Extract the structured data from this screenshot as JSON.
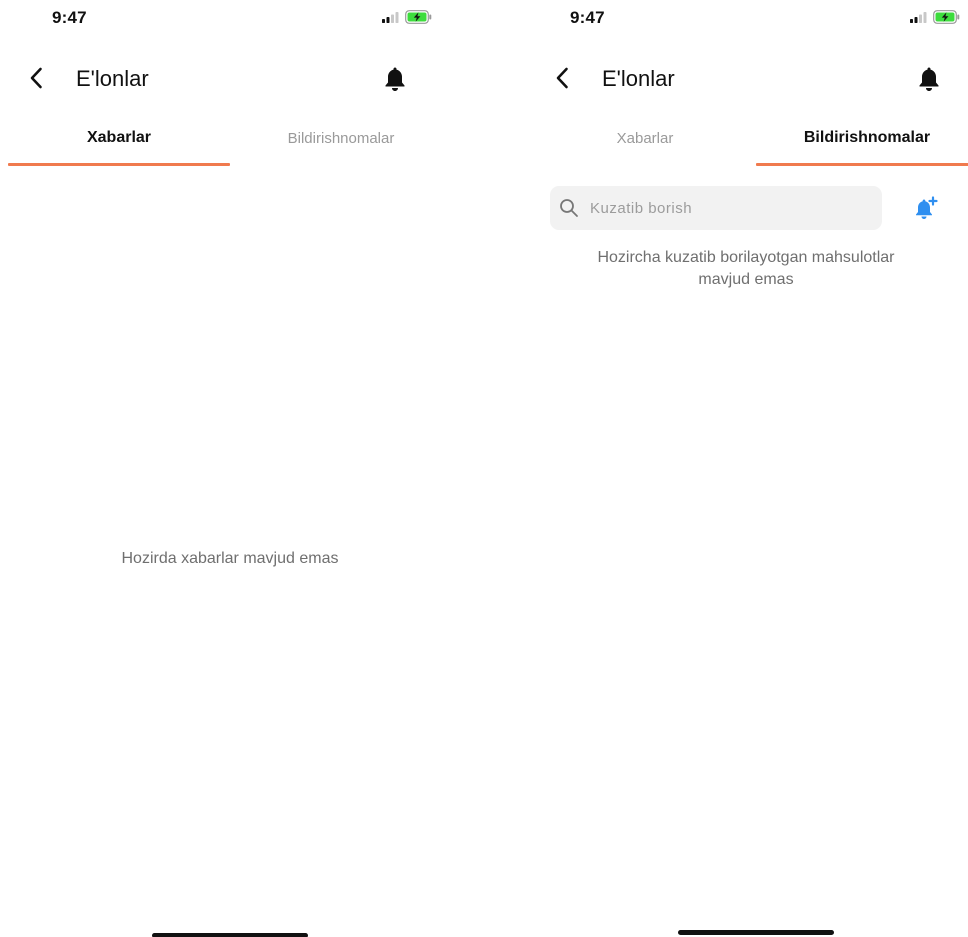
{
  "status_bar": {
    "time": "9:47",
    "icons": [
      "signal-icon",
      "battery-charging-icon"
    ],
    "battery_color": "#3ddc3d"
  },
  "nav": {
    "title": "E'lonlar",
    "back_icon": "chevron-left-icon",
    "bell_icon": "bell-icon"
  },
  "tabs": [
    {
      "label": "Xabarlar"
    },
    {
      "label": "Bildirishnomalar"
    }
  ],
  "screens": {
    "left": {
      "active_tab": 0,
      "empty_message": "Hozirda xabarlar mavjud emas"
    },
    "right": {
      "active_tab": 1,
      "search": {
        "placeholder": "Kuzatib borish",
        "value": ""
      },
      "add_icon": "bell-plus-icon",
      "empty_message_line1": "Hozircha kuzatib borilayotgan mahsulotlar",
      "empty_message_line2": "mavjud emas"
    }
  },
  "colors": {
    "accent_underline": "#f07a4e",
    "add_icon": "#2f8ff0",
    "muted_text": "#6f6f6f",
    "inactive_tab": "#9a9a9a"
  }
}
